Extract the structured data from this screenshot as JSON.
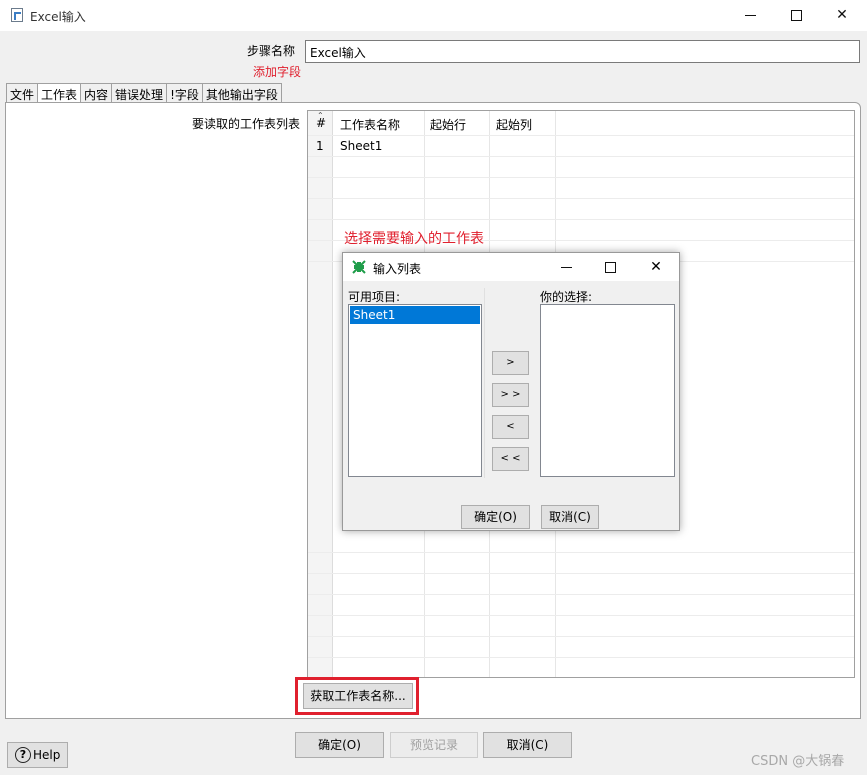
{
  "window": {
    "title": "Excel输入"
  },
  "step": {
    "label": "步骤名称",
    "value": "Excel输入",
    "add_field": "添加字段"
  },
  "tabs": [
    {
      "label": "文件",
      "active": false
    },
    {
      "label": "工作表",
      "active": true
    },
    {
      "label": "内容",
      "active": false
    },
    {
      "label": "错误处理",
      "active": false
    },
    {
      "label": "!字段",
      "active": false
    },
    {
      "label": "其他输出字段",
      "active": false
    }
  ],
  "sheets": {
    "label": "要读取的工作表列表",
    "columns": [
      "#",
      "工作表名称",
      "起始行",
      "起始列"
    ],
    "rows": [
      {
        "num": "1",
        "name": "Sheet1",
        "start_row": "",
        "start_col": ""
      }
    ]
  },
  "annotation": "选择需要输入的工作表",
  "dialog": {
    "title": "输入列表",
    "available_label": "可用项目:",
    "available_items": [
      "Sheet1"
    ],
    "selected_label": "你的选择:",
    "selected_items": [],
    "move_buttons": [
      ">",
      "> >",
      "<",
      "< <"
    ],
    "ok": "确定(O)",
    "cancel": "取消(C)"
  },
  "buttons": {
    "get_sheet_names": "获取工作表名称...",
    "help": "Help",
    "ok": "确定(O)",
    "preview": "预览记录",
    "cancel": "取消(C)"
  },
  "watermark": "CSDN @大锅春",
  "colors": {
    "annotation_red": "#e0202e",
    "selection_blue": "#0078d7"
  },
  "icons": {
    "app": "document-icon",
    "dialog": "shrink-arrows-icon",
    "help": "question-circle-icon"
  }
}
